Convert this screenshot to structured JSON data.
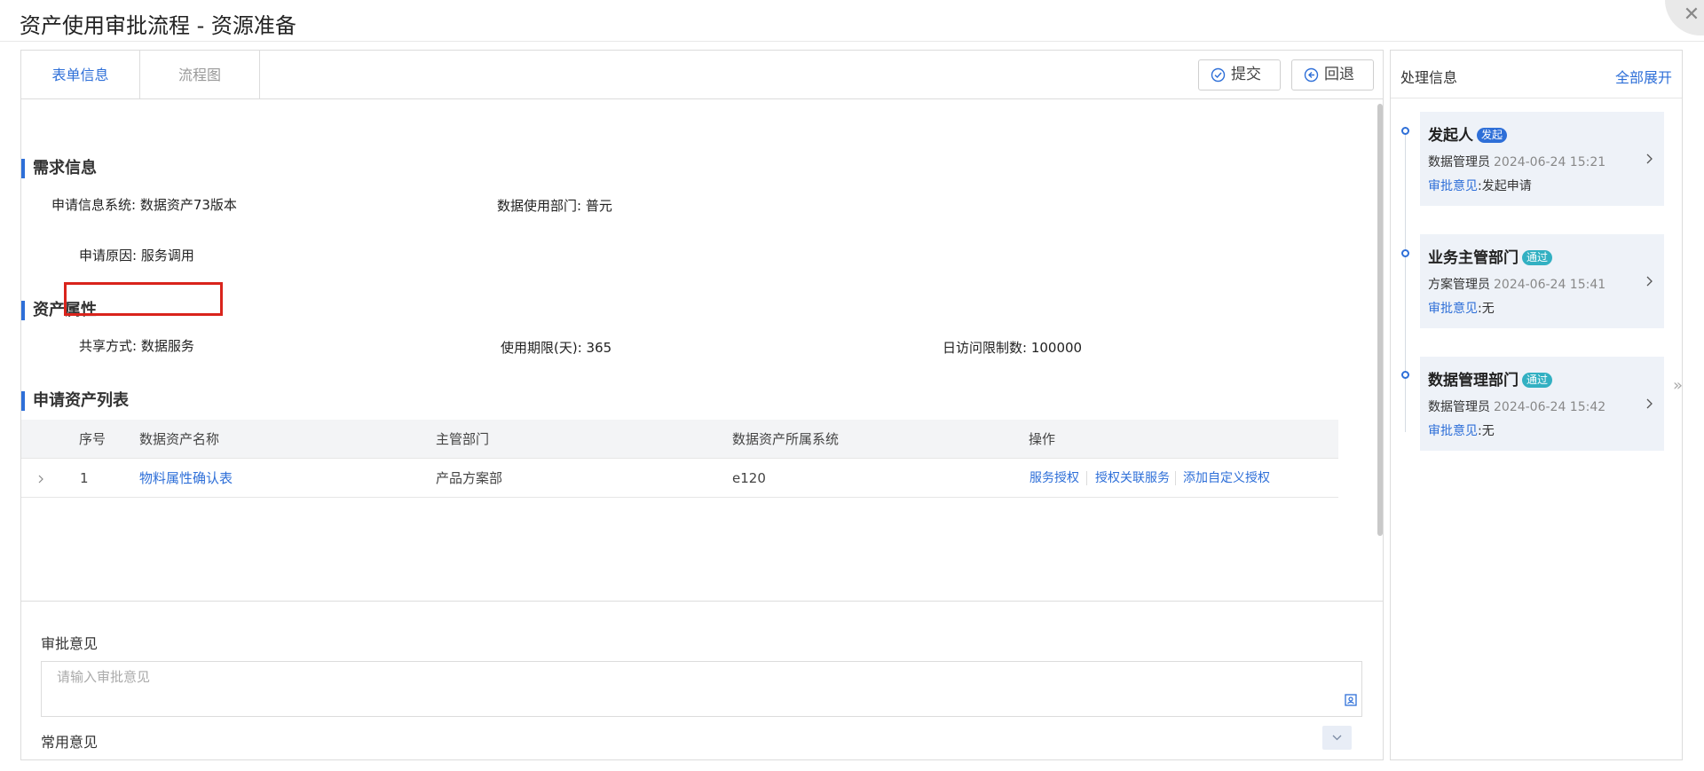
{
  "window": {
    "title": "资产使用审批流程 - 资源准备"
  },
  "tabs": [
    {
      "label": "表单信息"
    },
    {
      "label": "流程图"
    }
  ],
  "toolbar": {
    "submit_label": "提交",
    "back_label": "回退"
  },
  "demand": {
    "title": "需求信息",
    "system_label": "申请信息系统:",
    "system_value": "数据资产73版本",
    "dept_label": "数据使用部门:",
    "dept_value": "普元",
    "reason_label": "申请原因:",
    "reason_value": "服务调用"
  },
  "asset_attr": {
    "title": "资产属性",
    "share_label": "共享方式:",
    "share_value": "数据服务",
    "period_label": "使用期限(天):",
    "period_value": "365",
    "daily_label": "日访问限制数:",
    "daily_value": "100000"
  },
  "asset_list": {
    "title": "申请资产列表",
    "columns": [
      "序号",
      "数据资产名称",
      "主管部门",
      "数据资产所属系统",
      "操作"
    ],
    "rows": [
      {
        "index": "1",
        "name": "物料属性确认表",
        "dept": "产品方案部",
        "system": "e120",
        "ops": [
          "服务授权",
          "授权关联服务",
          "添加自定义授权"
        ]
      }
    ]
  },
  "opinion": {
    "label": "审批意见",
    "placeholder": "请输入审批意见",
    "common_label": "常用意见"
  },
  "process": {
    "title": "处理信息",
    "expand_all": "全部展开",
    "items": [
      {
        "title": "发起人",
        "badge": "发起",
        "user": "数据管理员",
        "time": "2024-06-24 15:21",
        "opinion_key": "审批意见",
        "opinion_value": ":发起申请"
      },
      {
        "title": "业务主管部门",
        "badge": "通过",
        "user": "方案管理员",
        "time": "2024-06-24 15:41",
        "opinion_key": "审批意见",
        "opinion_value": ":无"
      },
      {
        "title": "数据管理部门",
        "badge": "通过",
        "user": "数据管理员",
        "time": "2024-06-24 15:42",
        "opinion_key": "审批意见",
        "opinion_value": ":无"
      }
    ]
  },
  "colors": {
    "accent": "#2e6fd8",
    "highlight": "#d9241c",
    "pass_badge": "#32b0c2"
  }
}
